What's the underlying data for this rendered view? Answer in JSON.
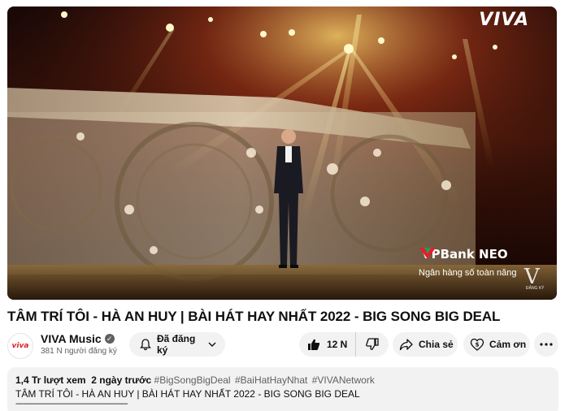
{
  "video": {
    "watermark": "VIVA",
    "sponsor_name": "VPBank NEO",
    "sponsor_tagline": "Ngân hàng số toàn năng",
    "subscribe_watermark_letter": "V",
    "subscribe_watermark_caption": "ĐĂNG KÝ"
  },
  "title": "TÂM TRÍ TÔI - HÀ AN HUY | BÀI HÁT HAY NHẤT 2022 - BIG SONG BIG DEAL",
  "channel": {
    "avatar_text": "viva",
    "name": "VIVA Music",
    "verified_icon": "verified-check-icon",
    "subscribers": "381 N người đăng ký"
  },
  "actions": {
    "subscribe_label": "Đã đăng ký",
    "like_count": "12 N",
    "share_label": "Chia sẻ",
    "thanks_label": "Cảm ơn"
  },
  "description": {
    "views": "1,4 Tr lượt xem",
    "age": "2 ngày trước",
    "hashtags": [
      "#BigSongBigDeal",
      "#BaiHatHayNhat",
      "#VIVANetwork"
    ],
    "line1": "TÂM TRÍ TÔI - HÀ AN HUY | BÀI HÁT HAY NHẤT 2022 - BIG SONG BIG DEAL",
    "divider": "-----------------------------------------------------------"
  },
  "colors": {
    "pill_bg": "#f2f2f2",
    "secondary_text": "#606060",
    "brand_red": "#e0202a"
  }
}
